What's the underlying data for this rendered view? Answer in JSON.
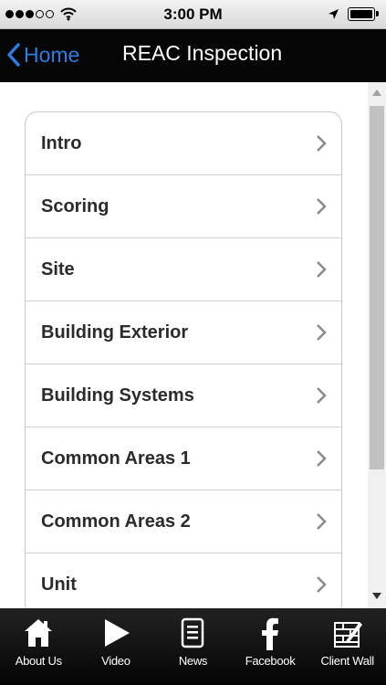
{
  "status_bar": {
    "time": "3:00 PM"
  },
  "nav": {
    "back_label": "Home",
    "title": "REAC Inspection"
  },
  "menu": {
    "items": [
      {
        "label": "Intro"
      },
      {
        "label": "Scoring"
      },
      {
        "label": "Site"
      },
      {
        "label": "Building Exterior"
      },
      {
        "label": "Building Systems"
      },
      {
        "label": "Common Areas 1"
      },
      {
        "label": "Common Areas 2"
      },
      {
        "label": "Unit"
      }
    ]
  },
  "tabs": [
    {
      "label": "About Us",
      "icon": "home-icon"
    },
    {
      "label": "Video",
      "icon": "play-icon"
    },
    {
      "label": "News",
      "icon": "news-icon"
    },
    {
      "label": "Facebook",
      "icon": "facebook-icon"
    },
    {
      "label": "Client Wall",
      "icon": "client-wall-icon"
    }
  ],
  "colors": {
    "accent": "#2d7de1",
    "nav_background": "#060606",
    "tab_background": "#111111"
  }
}
